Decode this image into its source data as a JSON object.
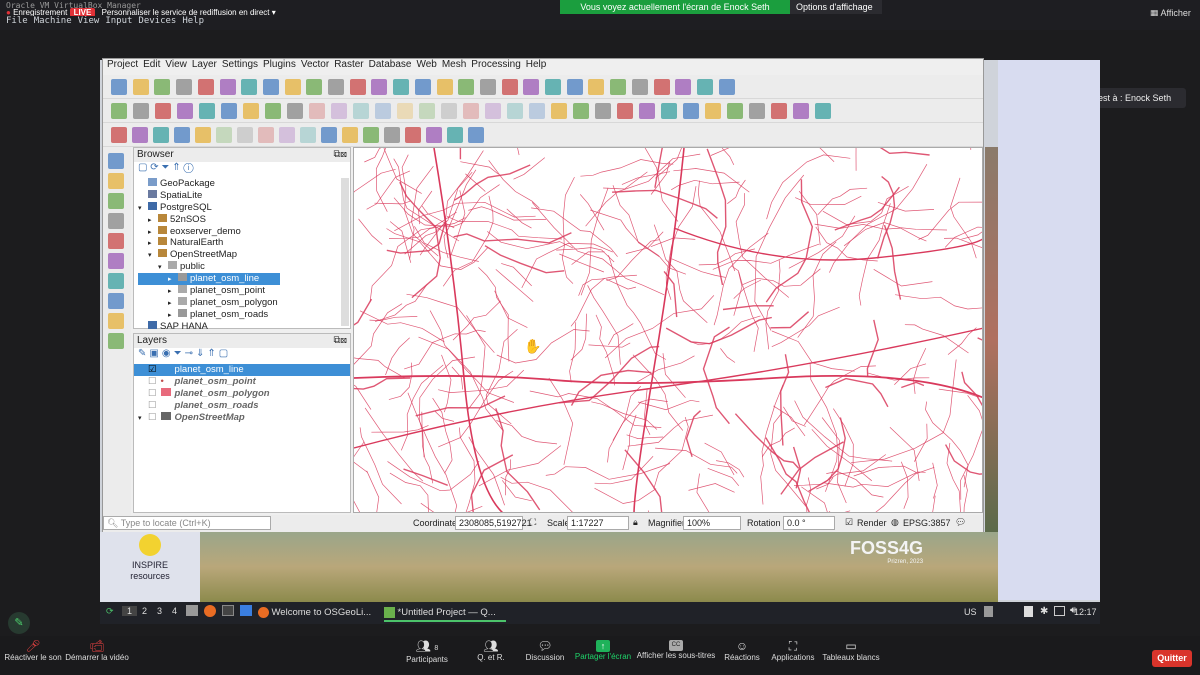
{
  "zoom_top": {
    "vm_title": "Oracle VM VirtualBox Manager",
    "recording": "Enregistrement",
    "live_badge": "LIVE",
    "stream_setting": "Personnaliser le service de rediffusion en direct",
    "share_banner": "Vous voyez actuellement l'écran de Enock Seth Nyamador",
    "view_options": "Options d'affichage",
    "view_label": "Afficher",
    "speaker_popup": "La parole est à : Enock Seth N..."
  },
  "vbox_menu": [
    "File",
    "Machine",
    "View",
    "Input",
    "Devices",
    "Help"
  ],
  "qgis": {
    "menu": [
      "Project",
      "Edit",
      "View",
      "Layer",
      "Settings",
      "Plugins",
      "Vector",
      "Raster",
      "Database",
      "Web",
      "Mesh",
      "Processing",
      "Help"
    ],
    "browser": {
      "title": "Browser",
      "items": [
        {
          "label": "GeoPackage",
          "level": 0,
          "arrow": "",
          "icon": "gpkg"
        },
        {
          "label": "SpatiaLite",
          "level": 0,
          "arrow": "",
          "icon": "feather"
        },
        {
          "label": "PostgreSQL",
          "level": 0,
          "arrow": "▾",
          "icon": "elephant"
        },
        {
          "label": "52nSOS",
          "level": 1,
          "arrow": "▸",
          "icon": "conn"
        },
        {
          "label": "eoxserver_demo",
          "level": 1,
          "arrow": "▸",
          "icon": "conn"
        },
        {
          "label": "NaturalEarth",
          "level": 1,
          "arrow": "▸",
          "icon": "conn"
        },
        {
          "label": "OpenStreetMap",
          "level": 1,
          "arrow": "▾",
          "icon": "conn"
        },
        {
          "label": "public",
          "level": 2,
          "arrow": "▾",
          "icon": "schema"
        },
        {
          "label": "planet_osm_line",
          "level": 3,
          "arrow": "▸",
          "icon": "line",
          "selected": true
        },
        {
          "label": "planet_osm_point",
          "level": 3,
          "arrow": "▸",
          "icon": "point"
        },
        {
          "label": "planet_osm_polygon",
          "level": 3,
          "arrow": "▸",
          "icon": "poly"
        },
        {
          "label": "planet_osm_roads",
          "level": 3,
          "arrow": "▸",
          "icon": "line"
        },
        {
          "label": "SAP HANA",
          "level": 0,
          "arrow": "",
          "icon": "db"
        }
      ]
    },
    "layers": {
      "title": "Layers",
      "items": [
        {
          "label": "planet_osm_line",
          "checked": true,
          "selected": true,
          "symbol": "line"
        },
        {
          "label": "planet_osm_point",
          "checked": false,
          "symbol": "point"
        },
        {
          "label": "planet_osm_polygon",
          "checked": false,
          "symbol": "poly"
        },
        {
          "label": "planet_osm_roads",
          "checked": false,
          "symbol": "line"
        },
        {
          "label": "OpenStreetMap",
          "checked": false,
          "symbol": "tiles"
        }
      ]
    },
    "status": {
      "locate_placeholder": "Type to locate (Ctrl+K)",
      "coordinate_label": "Coordinate",
      "coordinate_value": "2308085,5192721",
      "scale_label": "Scale",
      "scale_value": "1:17227",
      "magnifier_label": "Magnifier",
      "magnifier_value": "100%",
      "rotation_label": "Rotation",
      "rotation_value": "0.0 °",
      "render_label": "Render",
      "crs": "EPSG:3857"
    },
    "map_line_color": "#d9395c"
  },
  "desktop": {
    "inspire_label": "INSPIRE resources",
    "foss_logo": "FOSS4G",
    "foss_sub": "Prizren, 2023"
  },
  "taskbar": {
    "workspaces": [
      "1",
      "2",
      "3",
      "4"
    ],
    "firefox_window": "Welcome to OSGeoLi...",
    "qgis_window": "*Untitled Project — Q...",
    "keyboard": "US",
    "clock": "12:17"
  },
  "zoom_bottom": {
    "mute": "Réactiver le son",
    "video": "Démarrer la vidéo",
    "participants": "Participants",
    "participants_count": "8",
    "qa": "Q. et R.",
    "chat": "Discussion",
    "share": "Partager l'écran",
    "captions": "Afficher les sous-titres",
    "reactions": "Réactions",
    "apps": "Applications",
    "whiteboards": "Tableaux blancs",
    "quit": "Quitter"
  }
}
